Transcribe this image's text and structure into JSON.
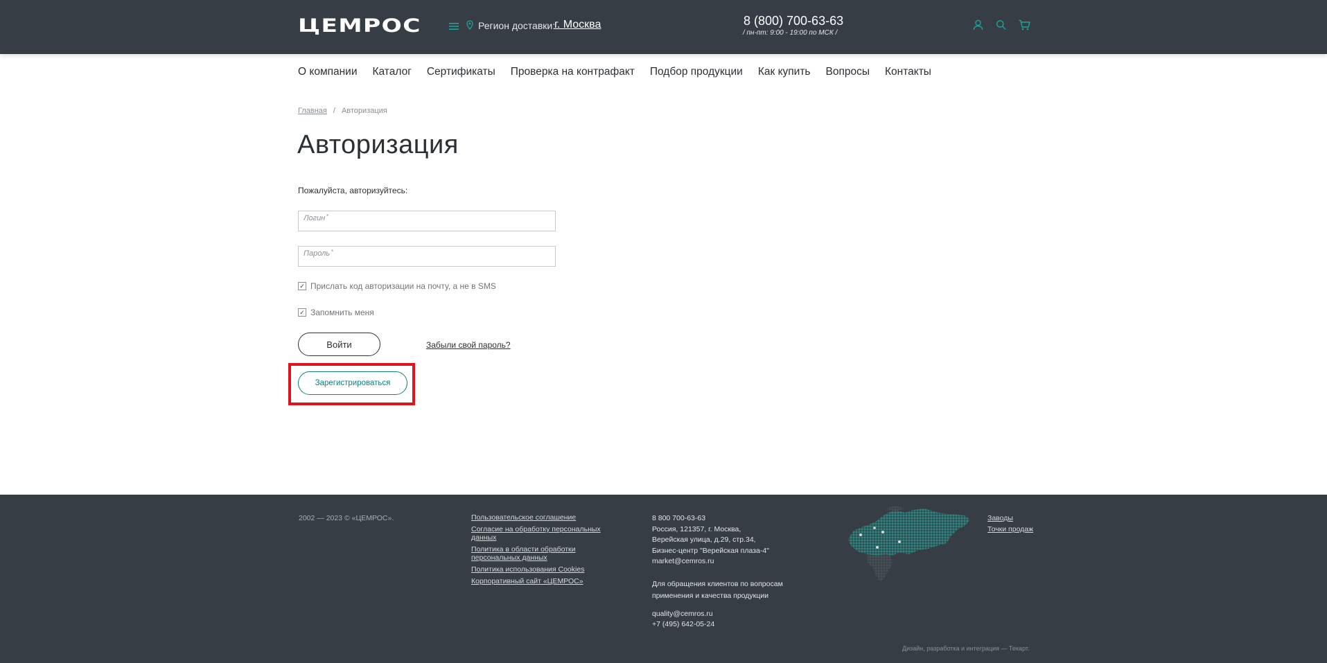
{
  "header": {
    "logo": "ЦЕМРОС",
    "region_label": "Регион доставки:",
    "region_city": "г. Москва",
    "phone": "8 (800) 700-63-63",
    "hours": "/ пн-пт: 9:00 - 19:00 по МСК  /",
    "icons": [
      "menu-icon",
      "location-pin-icon",
      "user-icon",
      "search-icon",
      "cart-icon"
    ],
    "accent_color": "#1fa39a"
  },
  "nav": {
    "items": [
      {
        "label": "О компании"
      },
      {
        "label": "Каталог"
      },
      {
        "label": "Сертификаты"
      },
      {
        "label": "Проверка на контрафакт"
      },
      {
        "label": "Подбор продукции"
      },
      {
        "label": "Как купить"
      },
      {
        "label": "Вопросы"
      },
      {
        "label": "Контакты"
      }
    ]
  },
  "breadcrumb": {
    "home": "Главная",
    "separator": "/",
    "current": "Авторизация"
  },
  "page": {
    "title": "Авторизация",
    "prompt": "Пожалуйста, авторизуйтесь:"
  },
  "form": {
    "login_placeholder": "Логин",
    "password_placeholder": "Пароль",
    "required_mark": "*",
    "email_code_label": "Прислать код авторизации на почту, а не в SMS",
    "email_code_checked": true,
    "remember_label": "Запомнить меня",
    "remember_checked": true,
    "check_mark": "✓",
    "login_button": "Войти",
    "forgot_link": "Забыли свой пароль?",
    "register_button": "Зарегистрироваться"
  },
  "footer": {
    "copyright": "2002 — 2023 © «ЦЕМРОС».",
    "links": [
      "Пользовательское соглашение",
      "Согласие на обработку персональных данных",
      "Политика в области обработки персональных данных",
      "Политика использования Cookies",
      "Корпоративный сайт «ЦЕМРОС»"
    ],
    "contact": {
      "phone": "8 800 700-63-63",
      "address_1": "Россия, 121357, г. Москва,",
      "address_2": "Верейская улица, д.29, стр.34,",
      "address_3": "Бизнес-центр \"Верейская плаза-4\"",
      "email": "market@cemros.ru",
      "quality_note_1": "Для обращения клиентов по вопросам",
      "quality_note_2": "применения и качества продукции",
      "quality_email": "quality@cemros.ru",
      "quality_phone": "+7 (495) 642-05-24"
    },
    "side_links": [
      "Заводы",
      "Точки продаж"
    ],
    "developer": "Дизайн, разработка и интеграция — Текарт."
  }
}
